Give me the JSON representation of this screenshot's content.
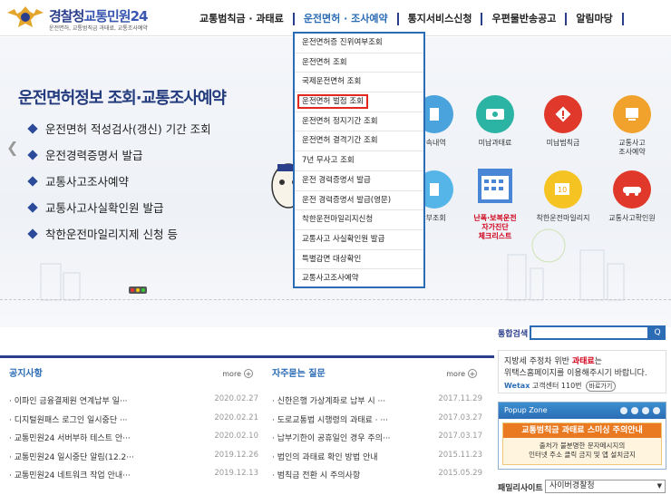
{
  "header": {
    "logo_part1": "경찰청",
    "logo_part2": "교통민원24",
    "logo_sub": "운전면허, 교통범칙금 과태료, 교통조사예약",
    "nav": [
      "교통범칙금 · 과태료",
      "운전면허 · 조사예약",
      "통지서비스신청",
      "우편물반송공고",
      "알림마당"
    ]
  },
  "hero": {
    "title": "운전면허정보 조회·교통조사예약",
    "items": [
      "운전면허 적성검사(갱신) 기간 조회",
      "운전경력증명서 발급",
      "교통사고조사예약",
      "교통사고사실확인원 발급",
      "착한운전마일리지제 신청 등"
    ]
  },
  "services": {
    "s1": "단속내역",
    "s2": "미납과태료",
    "s3": "미납범칙금",
    "s4a": "교통사고",
    "s4b": "조사예약",
    "s5": "납부조회",
    "s6a": "난폭·보복운전",
    "s6b": "자가진단",
    "s6c": "체크리스트",
    "s7": "착한운전마일리지",
    "s8": "교통사고확인원"
  },
  "dropdown": {
    "items": [
      "운전면허증 진위여부조회",
      "운전면허 조회",
      "국제운전면허 조회",
      "운전면허 벌점 조회",
      "운전면허 정지기간 조회",
      "운전면허 결격기간 조회",
      "7년 무사고 조회",
      "운전 경력증명서 발급",
      "운전 경력증명서 발급(영문)",
      "착한운전마일리지신청",
      "교통사고 사실확인원 발급",
      "특별감면 대상확인",
      "교통사고조사예약"
    ]
  },
  "notice": {
    "title": "공지사항",
    "more": "more",
    "rows": [
      {
        "t": "이파인 금융결제원 연계납부 일···",
        "d": "2020.02.27"
      },
      {
        "t": "디지털원패스 로그인 일시중단 ···",
        "d": "2020.02.21"
      },
      {
        "t": "교통민원24 서버부하 테스트 안···",
        "d": "2020.02.10"
      },
      {
        "t": "교통민원24 일시중단 알림(12.2···",
        "d": "2019.12.26"
      },
      {
        "t": "교통민원24 네트워크 작업 안내···",
        "d": "2019.12.13"
      }
    ]
  },
  "faq": {
    "title": "자주묻는 질문",
    "more": "more",
    "rows": [
      {
        "t": "신한은행 가상계좌로 납부 시 ···",
        "d": "2017.11.29"
      },
      {
        "t": "도로교통법 시행령의 과태료 · ···",
        "d": "2017.03.27"
      },
      {
        "t": "납부기한이 공휴일인 경우 주의···",
        "d": "2017.03.17"
      },
      {
        "t": "법인의 과태료 확인 방법 안내",
        "d": "2015.11.23"
      },
      {
        "t": "범칙금 전환 시 주의사항",
        "d": "2015.05.29"
      }
    ]
  },
  "search": {
    "label": "통합검색",
    "btn": "Q"
  },
  "banner": {
    "l1a": "지방세 주정차 위반 ",
    "l1b": "과태료",
    "l1c": "는",
    "l2": "위택스홈페이지를 이용해주시기 바랍니다.",
    "l3a": "W",
    "l3b": "etax",
    "l3c": " 고객센터 110번",
    "tag": "바로가기"
  },
  "popup": {
    "title": "Popup Zone",
    "b1": "교통범칙금 과태료 스미싱 주의안내",
    "b2a": "출처가 불분명한 문자메시지의",
    "b2b": "인터넷 주소 클릭 금지 및 앱 설치금지"
  },
  "family": {
    "label": "패밀리사이트",
    "value": "사이버경찰청"
  },
  "colors": {
    "brand": "#2b3e8c",
    "accent": "#2b6cb5",
    "highlight": "#e0281f"
  }
}
